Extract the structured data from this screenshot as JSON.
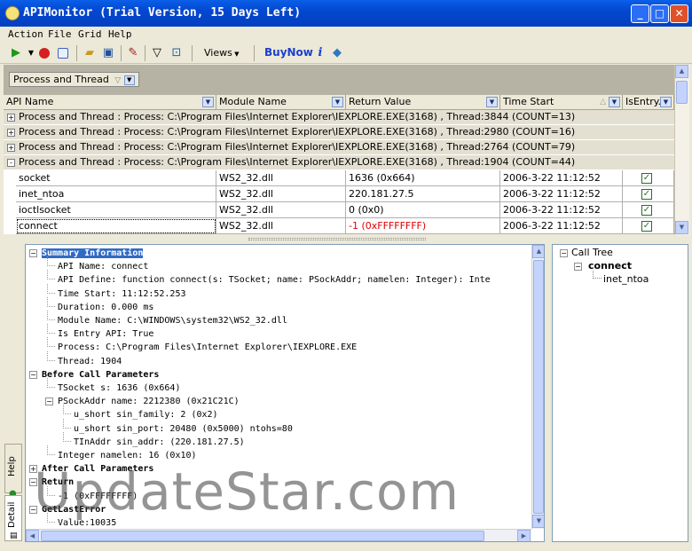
{
  "window": {
    "title": "APIMonitor  (Trial Version, 15 Days Left)",
    "minimize": "_",
    "maximize": "□",
    "close": "✕"
  },
  "menu": [
    "Action",
    "File",
    "Grid",
    "Help"
  ],
  "toolbar": {
    "views_label": "Views",
    "buynow_label": "BuyNow",
    "info_label": "i",
    "icons": [
      "run-icon",
      "dropdown-icon",
      "stop-icon",
      "open-icon",
      "save-icon",
      "clear-icon",
      "filter-icon",
      "options-icon",
      "info-icon",
      "help-book-icon"
    ]
  },
  "group_by": {
    "label": "Process and Thread"
  },
  "grid": {
    "columns": [
      {
        "label": "API Name"
      },
      {
        "label": "Module Name"
      },
      {
        "label": "Return Value"
      },
      {
        "label": "Time Start"
      },
      {
        "label": "IsEntry..."
      }
    ],
    "groups": [
      {
        "sign": "+",
        "text": "Process and Thread : Process: C:\\Program Files\\Internet Explorer\\IEXPLORE.EXE(3168) , Thread:3844 (COUNT=13)"
      },
      {
        "sign": "+",
        "text": "Process and Thread : Process: C:\\Program Files\\Internet Explorer\\IEXPLORE.EXE(3168) , Thread:2980 (COUNT=16)"
      },
      {
        "sign": "+",
        "text": "Process and Thread : Process: C:\\Program Files\\Internet Explorer\\IEXPLORE.EXE(3168) , Thread:2764 (COUNT=79)"
      },
      {
        "sign": "-",
        "text": "Process and Thread : Process: C:\\Program Files\\Internet Explorer\\IEXPLORE.EXE(3168) , Thread:1904 (COUNT=44)"
      }
    ],
    "rows": [
      {
        "api": "socket",
        "module": "WS2_32.dll",
        "ret": "1636 (0x664)",
        "time": "2006-3-22 11:12:52",
        "entry": true
      },
      {
        "api": "inet_ntoa",
        "module": "WS2_32.dll",
        "ret": "220.181.27.5",
        "time": "2006-3-22 11:12:52",
        "entry": true
      },
      {
        "api": "ioctlsocket",
        "module": "WS2_32.dll",
        "ret": "0 (0x0)",
        "time": "2006-3-22 11:12:52",
        "entry": true
      },
      {
        "api": "connect",
        "module": "WS2_32.dll",
        "ret": "-1 (0xFFFFFFFF)",
        "time": "2006-3-22 11:12:52",
        "entry": true
      }
    ],
    "error_color": "#e00000"
  },
  "detail": {
    "lines": [
      {
        "text": "Summary Information",
        "bold": true,
        "selected": true,
        "sign": "-"
      },
      {
        "text": "API Name: connect"
      },
      {
        "text": "API Define: function connect(s: TSocket; name: PSockAddr; namelen: Integer): Inte"
      },
      {
        "text": "Time Start: 11:12:52.253"
      },
      {
        "text": "Duration: 0.000 ms"
      },
      {
        "text": "Module Name: C:\\WINDOWS\\system32\\WS2_32.dll"
      },
      {
        "text": "Is Entry API: True"
      },
      {
        "text": "Process: C:\\Program Files\\Internet Explorer\\IEXPLORE.EXE"
      },
      {
        "text": "Thread: 1904"
      },
      {
        "text": "Before Call Parameters",
        "bold": true,
        "sign": "-"
      },
      {
        "text": "TSocket  s: 1636 (0x664)"
      },
      {
        "text": "PSockAddr  name: 2212380 (0x21C21C)",
        "sign": "-"
      },
      {
        "text": "u_short  sin_family: 2 (0x2)"
      },
      {
        "text": "u_short  sin_port: 20480 (0x5000) ntohs=80"
      },
      {
        "text": "TInAddr  sin_addr: (220.181.27.5)"
      },
      {
        "text": "Integer  namelen: 16 (0x10)"
      },
      {
        "text": "After Call Parameters",
        "bold": true,
        "sign": "+"
      },
      {
        "text": "Return",
        "bold": true,
        "sign": "-"
      },
      {
        "text": "-1 (0xFFFFFFFF)"
      },
      {
        "text": "GetLastError",
        "bold": true,
        "sign": "-"
      },
      {
        "text": "Value:10035"
      }
    ]
  },
  "side_tabs": [
    "Help",
    "Detail"
  ],
  "call_tree": {
    "root": "Call Tree",
    "child": "connect",
    "leaf": "inet_ntoa"
  },
  "watermark": "UpdateStar.com"
}
